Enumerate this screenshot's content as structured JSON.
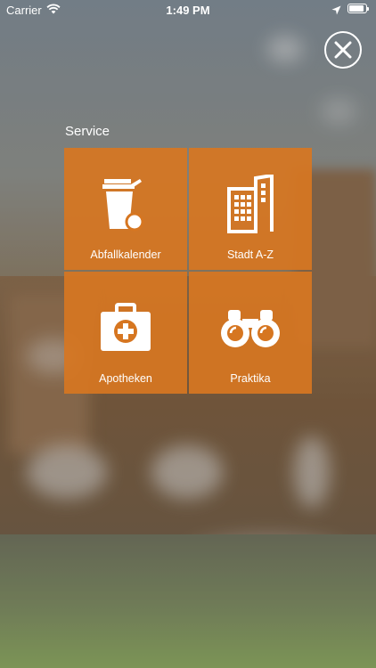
{
  "status_bar": {
    "carrier": "Carrier",
    "time": "1:49 PM"
  },
  "menu": {
    "section_title": "Service",
    "tiles": [
      {
        "label": "Abfallkalender",
        "icon": "trash-bin-icon"
      },
      {
        "label": "Stadt A-Z",
        "icon": "city-buildings-icon"
      },
      {
        "label": "Apotheken",
        "icon": "first-aid-kit-icon"
      },
      {
        "label": "Praktika",
        "icon": "binoculars-icon"
      }
    ],
    "tile_color": "#D67621"
  }
}
